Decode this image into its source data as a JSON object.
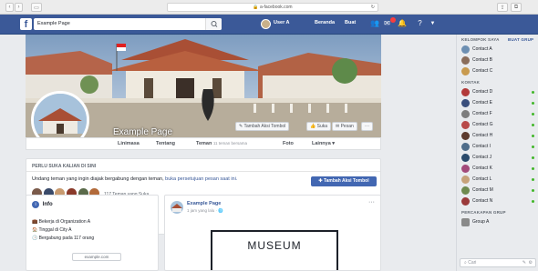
{
  "browser": {
    "url": "a-facebook.com",
    "back": "‹",
    "forward": "›"
  },
  "fbbar": {
    "search_value": "Example Page",
    "profile_name": "User A",
    "home": "Beranda",
    "find_friends": "Buat"
  },
  "page": {
    "name": "Example Page",
    "cover_buttons": [
      "Tambah Aksi Tombol",
      "Suka",
      "Pesan",
      "···"
    ],
    "tabs": [
      "Linimasa",
      "Tentang",
      "Teman",
      "Foto",
      "Lainnya ▾"
    ],
    "tab_friends_sub": "11 teman bersama"
  },
  "friends_card": {
    "header": "PERLU SUKA KALIAN DI SINI",
    "text_a": "Undang teman yang ingin diajak bergabung dengan teman,",
    "text_b": "buka persetujuan pesan saat ini.",
    "count": "117 Teman yang Suka",
    "button": "Tambah Aksi Tombol"
  },
  "intro": {
    "title": "Info",
    "lines": [
      "Bekerja di Organization A",
      "Tinggal di City A",
      "Bergabung pada 117 orang"
    ],
    "link": "example.com"
  },
  "post": {
    "author": "Example Page",
    "subtitle": "1 jam yang lalu · 🌐",
    "museum": "MUSEUM",
    "more": "···"
  },
  "rightrail": {
    "section1": "KELOMPOK SAYA",
    "section1_more": "BUAT GRUP",
    "section2": "KONTAK",
    "section3": "PERCAKAPAN GRUP",
    "people": [
      {
        "name": "Contact A",
        "color": "#6d8fb2",
        "online": false
      },
      {
        "name": "Contact B",
        "color": "#8a6d5b",
        "online": false
      },
      {
        "name": "Contact C",
        "color": "#c89a4f",
        "online": false
      },
      {
        "name": "Contact D",
        "color": "#b23a3a",
        "online": true
      },
      {
        "name": "Contact E",
        "color": "#3a4f7d",
        "online": true
      },
      {
        "name": "Contact F",
        "color": "#7d7d7d",
        "online": true
      },
      {
        "name": "Contact G",
        "color": "#b84a4a",
        "online": true
      },
      {
        "name": "Contact H",
        "color": "#5c3a2e",
        "online": true
      },
      {
        "name": "Contact I",
        "color": "#4f6d8a",
        "online": true
      },
      {
        "name": "Contact J",
        "color": "#2a4a6b",
        "online": true
      },
      {
        "name": "Contact K",
        "color": "#a34a7a",
        "online": true
      },
      {
        "name": "Contact L",
        "color": "#c6a27a",
        "online": true
      },
      {
        "name": "Contact M",
        "color": "#6e8a4f",
        "online": true
      },
      {
        "name": "Contact N",
        "color": "#9a3a3a",
        "online": true
      }
    ],
    "group": "Group A",
    "footer": "Cari"
  }
}
